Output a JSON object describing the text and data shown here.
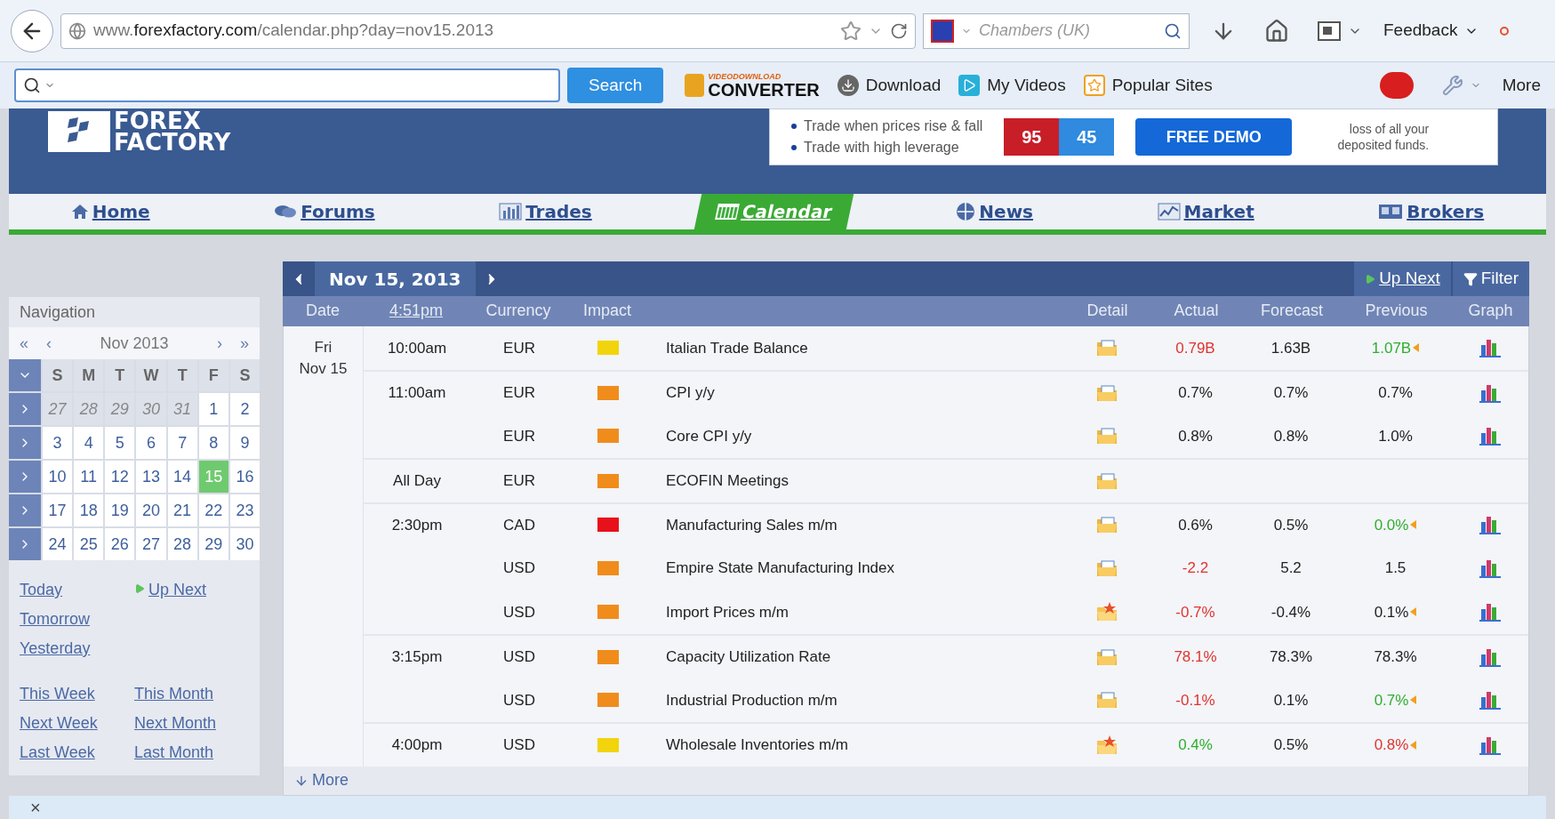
{
  "browser": {
    "url": {
      "prefix": "www.",
      "host": "forexfactory.com",
      "path": "/calendar.php?day=nov15.2013"
    },
    "search_engine": {
      "placeholder": "Chambers (UK)"
    },
    "feedback": "Feedback"
  },
  "toolbar": {
    "search_button": "Search",
    "converter_logo": {
      "top": "VIDEODOWNLOAD",
      "bottom": "CONVERTER"
    },
    "items": [
      "Download",
      "My Videos",
      "Popular Sites"
    ],
    "more": "More"
  },
  "site": {
    "logo": {
      "line1": "FOREX",
      "line2": "FACTORY"
    },
    "ad": {
      "bullets": [
        "Trade when prices rise & fall",
        "Trade with high leverage"
      ],
      "prices": [
        "95",
        "45"
      ],
      "button": "FREE DEMO",
      "disclaimer": "loss of all your deposited funds."
    }
  },
  "nav": [
    {
      "label": "Home",
      "selected": false
    },
    {
      "label": "Forums",
      "selected": false
    },
    {
      "label": "Trades",
      "selected": false
    },
    {
      "label": "Calendar",
      "selected": true
    },
    {
      "label": "News",
      "selected": false
    },
    {
      "label": "Market",
      "selected": false
    },
    {
      "label": "Brokers",
      "selected": false
    }
  ],
  "sidebar": {
    "title": "Navigation",
    "month": "Nov 2013",
    "arrows": [
      "«",
      "‹",
      "›",
      "»"
    ],
    "weekdays": [
      "S",
      "M",
      "T",
      "W",
      "T",
      "F",
      "S"
    ],
    "weeks": [
      [
        {
          "day": "27",
          "other_month": true,
          "selected": false
        },
        {
          "day": "28",
          "other_month": true,
          "selected": false
        },
        {
          "day": "29",
          "other_month": true,
          "selected": false
        },
        {
          "day": "30",
          "other_month": true,
          "selected": false
        },
        {
          "day": "31",
          "other_month": true,
          "selected": false
        },
        {
          "day": "1",
          "other_month": false,
          "selected": false
        },
        {
          "day": "2",
          "other_month": false,
          "selected": false
        }
      ],
      [
        {
          "day": "3",
          "other_month": false,
          "selected": false
        },
        {
          "day": "4",
          "other_month": false,
          "selected": false
        },
        {
          "day": "5",
          "other_month": false,
          "selected": false
        },
        {
          "day": "6",
          "other_month": false,
          "selected": false
        },
        {
          "day": "7",
          "other_month": false,
          "selected": false
        },
        {
          "day": "8",
          "other_month": false,
          "selected": false
        },
        {
          "day": "9",
          "other_month": false,
          "selected": false
        }
      ],
      [
        {
          "day": "10",
          "other_month": false,
          "selected": false
        },
        {
          "day": "11",
          "other_month": false,
          "selected": false
        },
        {
          "day": "12",
          "other_month": false,
          "selected": false
        },
        {
          "day": "13",
          "other_month": false,
          "selected": false
        },
        {
          "day": "14",
          "other_month": false,
          "selected": false
        },
        {
          "day": "15",
          "other_month": false,
          "selected": true
        },
        {
          "day": "16",
          "other_month": false,
          "selected": false
        }
      ],
      [
        {
          "day": "17",
          "other_month": false,
          "selected": false
        },
        {
          "day": "18",
          "other_month": false,
          "selected": false
        },
        {
          "day": "19",
          "other_month": false,
          "selected": false
        },
        {
          "day": "20",
          "other_month": false,
          "selected": false
        },
        {
          "day": "21",
          "other_month": false,
          "selected": false
        },
        {
          "day": "22",
          "other_month": false,
          "selected": false
        },
        {
          "day": "23",
          "other_month": false,
          "selected": false
        }
      ],
      [
        {
          "day": "24",
          "other_month": false,
          "selected": false
        },
        {
          "day": "25",
          "other_month": false,
          "selected": false
        },
        {
          "day": "26",
          "other_month": false,
          "selected": false
        },
        {
          "day": "27",
          "other_month": false,
          "selected": false
        },
        {
          "day": "28",
          "other_month": false,
          "selected": false
        },
        {
          "day": "29",
          "other_month": false,
          "selected": false
        },
        {
          "day": "30",
          "other_month": false,
          "selected": false
        }
      ]
    ],
    "links_left": [
      "Today",
      "Tomorrow",
      "Yesterday"
    ],
    "up_next": "Up Next",
    "links_bottom": [
      [
        "This Week",
        "This Month"
      ],
      [
        "Next Week",
        "Next Month"
      ],
      [
        "Last Week",
        "Last Month"
      ]
    ]
  },
  "calendar": {
    "date": "Nov 15, 2013",
    "up_next": "Up Next",
    "filter": "Filter",
    "columns": [
      "Date",
      "4:51pm",
      "Currency",
      "Impact",
      "",
      "Detail",
      "Actual",
      "Forecast",
      "Previous",
      "Graph"
    ],
    "day": {
      "weekday": "Fri",
      "date": "Nov 15"
    },
    "rows": [
      {
        "time": "10:00am",
        "currency": "EUR",
        "impact": {
          "color": "#f2d40c"
        },
        "event": "Italian Trade Balance",
        "starred": false,
        "actual": {
          "text": "0.79B",
          "color": "#e0342e"
        },
        "forecast": "1.63B",
        "previous": {
          "text": "1.07B",
          "color": "#2fae2f",
          "revised": true
        },
        "graph": true
      },
      {
        "time": "11:00am",
        "currency": "EUR",
        "impact": {
          "color": "#f08c1c"
        },
        "event": "CPI y/y",
        "starred": false,
        "actual": {
          "text": "0.7%",
          "color": "#222222"
        },
        "forecast": "0.7%",
        "previous": {
          "text": "0.7%",
          "color": "#222222",
          "revised": false
        },
        "graph": true
      },
      {
        "currency": "EUR",
        "impact": {
          "color": "#f08c1c"
        },
        "event": "Core CPI y/y",
        "starred": false,
        "actual": {
          "text": "0.8%",
          "color": "#222222"
        },
        "forecast": "0.8%",
        "previous": {
          "text": "1.0%",
          "color": "#222222",
          "revised": false
        },
        "graph": true
      },
      {
        "time": "All Day",
        "currency": "EUR",
        "impact": {
          "color": "#f08c1c"
        },
        "event": "ECOFIN Meetings",
        "starred": false,
        "graph": false
      },
      {
        "time": "2:30pm",
        "currency": "CAD",
        "impact": {
          "color": "#e8101a"
        },
        "event": "Manufacturing Sales m/m",
        "starred": false,
        "actual": {
          "text": "0.6%",
          "color": "#222222"
        },
        "forecast": "0.5%",
        "previous": {
          "text": "0.0%",
          "color": "#2fae2f",
          "revised": true
        },
        "graph": true
      },
      {
        "currency": "USD",
        "impact": {
          "color": "#f08c1c"
        },
        "event": "Empire State Manufacturing Index",
        "starred": false,
        "actual": {
          "text": "-2.2",
          "color": "#e0342e"
        },
        "forecast": "5.2",
        "previous": {
          "text": "1.5",
          "color": "#222222",
          "revised": false
        },
        "graph": true
      },
      {
        "currency": "USD",
        "impact": {
          "color": "#f08c1c"
        },
        "event": "Import Prices m/m",
        "starred": true,
        "actual": {
          "text": "-0.7%",
          "color": "#e0342e"
        },
        "forecast": "-0.4%",
        "previous": {
          "text": "0.1%",
          "color": "#222222",
          "revised": true
        },
        "graph": true
      },
      {
        "time": "3:15pm",
        "currency": "USD",
        "impact": {
          "color": "#f08c1c"
        },
        "event": "Capacity Utilization Rate",
        "starred": false,
        "actual": {
          "text": "78.1%",
          "color": "#e0342e"
        },
        "forecast": "78.3%",
        "previous": {
          "text": "78.3%",
          "color": "#222222",
          "revised": false
        },
        "graph": true
      },
      {
        "currency": "USD",
        "impact": {
          "color": "#f08c1c"
        },
        "event": "Industrial Production m/m",
        "starred": false,
        "actual": {
          "text": "-0.1%",
          "color": "#e0342e"
        },
        "forecast": "0.1%",
        "previous": {
          "text": "0.7%",
          "color": "#2fae2f",
          "revised": true
        },
        "graph": true
      },
      {
        "time": "4:00pm",
        "currency": "USD",
        "impact": {
          "color": "#f2d40c"
        },
        "event": "Wholesale Inventories m/m",
        "starred": true,
        "actual": {
          "text": "0.4%",
          "color": "#2fae2f"
        },
        "forecast": "0.5%",
        "previous": {
          "text": "0.8%",
          "color": "#e0342e",
          "revised": true
        },
        "graph": true
      }
    ],
    "more": "More"
  },
  "bottom_bar": {
    "close": "×"
  }
}
